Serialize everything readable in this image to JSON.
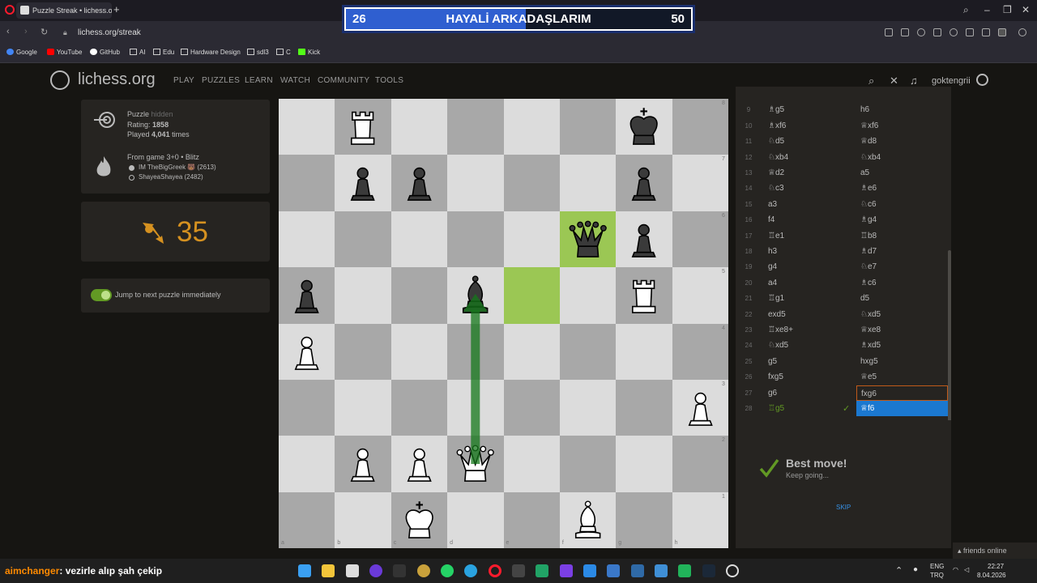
{
  "browser": {
    "tab_title": "Puzzle Streak • lichess.org",
    "url": "lichess.org/streak",
    "bookmarks": [
      "Google",
      "YouTube",
      "GitHub",
      "AI",
      "Edu",
      "Hardware Design",
      "sdl3",
      "C",
      "Kick"
    ]
  },
  "overlay": {
    "left_score": "26",
    "title": "HAYALİ ARKADAŞLARIM",
    "right_score": "50",
    "progress_fraction": 0.52,
    "fill_color": "#2f5fd0"
  },
  "site": {
    "logo": "lichess.org",
    "nav": [
      "PLAY",
      "PUZZLES",
      "LEARN",
      "WATCH",
      "COMMUNITY",
      "TOOLS"
    ],
    "username": "goktengrii"
  },
  "puzzle": {
    "label": "Puzzle",
    "hidden_label": "hidden",
    "rating_label": "Rating:",
    "rating": "1858",
    "played_prefix": "Played",
    "played_count": "4,041",
    "played_suffix": "times",
    "game_info": "From game 3+0 • Blitz",
    "white_player": "IM TheBigGreek 🐻 (2613)",
    "black_player": "ShayeaShayea (2482)"
  },
  "streak": {
    "count": "35"
  },
  "jump_toggle": {
    "label": "Jump to next puzzle immediately",
    "on": true
  },
  "board": {
    "rank_labels": [
      "8",
      "7",
      "6",
      "5",
      "4",
      "3",
      "2",
      "1"
    ],
    "file_labels": [
      "a",
      "b",
      "c",
      "d",
      "e",
      "f",
      "g",
      "h"
    ],
    "highlight_squares": [
      "f6",
      "e5"
    ],
    "arrow": {
      "from": "d2",
      "to": "d5"
    },
    "pieces": [
      {
        "sq": "b8",
        "type": "rook",
        "color": "white"
      },
      {
        "sq": "g8",
        "type": "king",
        "color": "black"
      },
      {
        "sq": "b7",
        "type": "pawn",
        "color": "black"
      },
      {
        "sq": "c7",
        "type": "pawn",
        "color": "black"
      },
      {
        "sq": "g7",
        "type": "pawn",
        "color": "black"
      },
      {
        "sq": "f6",
        "type": "queen",
        "color": "black"
      },
      {
        "sq": "g6",
        "type": "pawn",
        "color": "black"
      },
      {
        "sq": "a5",
        "type": "pawn",
        "color": "black"
      },
      {
        "sq": "d5",
        "type": "bishop",
        "color": "black"
      },
      {
        "sq": "g5",
        "type": "rook",
        "color": "white"
      },
      {
        "sq": "a4",
        "type": "pawn",
        "color": "white"
      },
      {
        "sq": "h3",
        "type": "pawn",
        "color": "white"
      },
      {
        "sq": "b2",
        "type": "pawn",
        "color": "white"
      },
      {
        "sq": "c2",
        "type": "pawn",
        "color": "white"
      },
      {
        "sq": "d2",
        "type": "queen",
        "color": "white"
      },
      {
        "sq": "c1",
        "type": "king",
        "color": "white"
      },
      {
        "sq": "f1",
        "type": "bishop",
        "color": "white"
      }
    ]
  },
  "moves": [
    {
      "n": "",
      "w": "",
      "b": ""
    },
    {
      "n": "9",
      "w": "♗g5",
      "b": "h6"
    },
    {
      "n": "10",
      "w": "♗xf6",
      "b": "♕xf6"
    },
    {
      "n": "11",
      "w": "♘d5",
      "b": "♕d8"
    },
    {
      "n": "12",
      "w": "♘xb4",
      "b": "♘xb4"
    },
    {
      "n": "13",
      "w": "♕d2",
      "b": "a5"
    },
    {
      "n": "14",
      "w": "♘c3",
      "b": "♗e6"
    },
    {
      "n": "15",
      "w": "a3",
      "b": "♘c6"
    },
    {
      "n": "16",
      "w": "f4",
      "b": "♗g4"
    },
    {
      "n": "17",
      "w": "♖e1",
      "b": "♖b8"
    },
    {
      "n": "18",
      "w": "h3",
      "b": "♗d7"
    },
    {
      "n": "19",
      "w": "g4",
      "b": "♘e7"
    },
    {
      "n": "20",
      "w": "a4",
      "b": "♗c6"
    },
    {
      "n": "21",
      "w": "♖g1",
      "b": "d5"
    },
    {
      "n": "22",
      "w": "exd5",
      "b": "♘xd5"
    },
    {
      "n": "23",
      "w": "♖xe8+",
      "b": "♕xe8"
    },
    {
      "n": "24",
      "w": "♘xd5",
      "b": "♗xd5"
    },
    {
      "n": "25",
      "w": "g5",
      "b": "hxg5"
    },
    {
      "n": "26",
      "w": "fxg5",
      "b": "♕e5"
    },
    {
      "n": "27",
      "w": "g6",
      "b": "fxg6"
    },
    {
      "n": "28",
      "w": "♖g5",
      "b": "♕f6"
    }
  ],
  "feedback": {
    "title": "Best move!",
    "subtitle": "Keep going...",
    "skip": "SKIP"
  },
  "friends": "friends online",
  "taskbar": {
    "chat_user": "aimchanger",
    "chat_msg": ": vezirle alıp şah çekip",
    "lang_top": "ENG",
    "lang_bottom": "TRQ",
    "time": "22:27",
    "date": "8.04.2026"
  }
}
